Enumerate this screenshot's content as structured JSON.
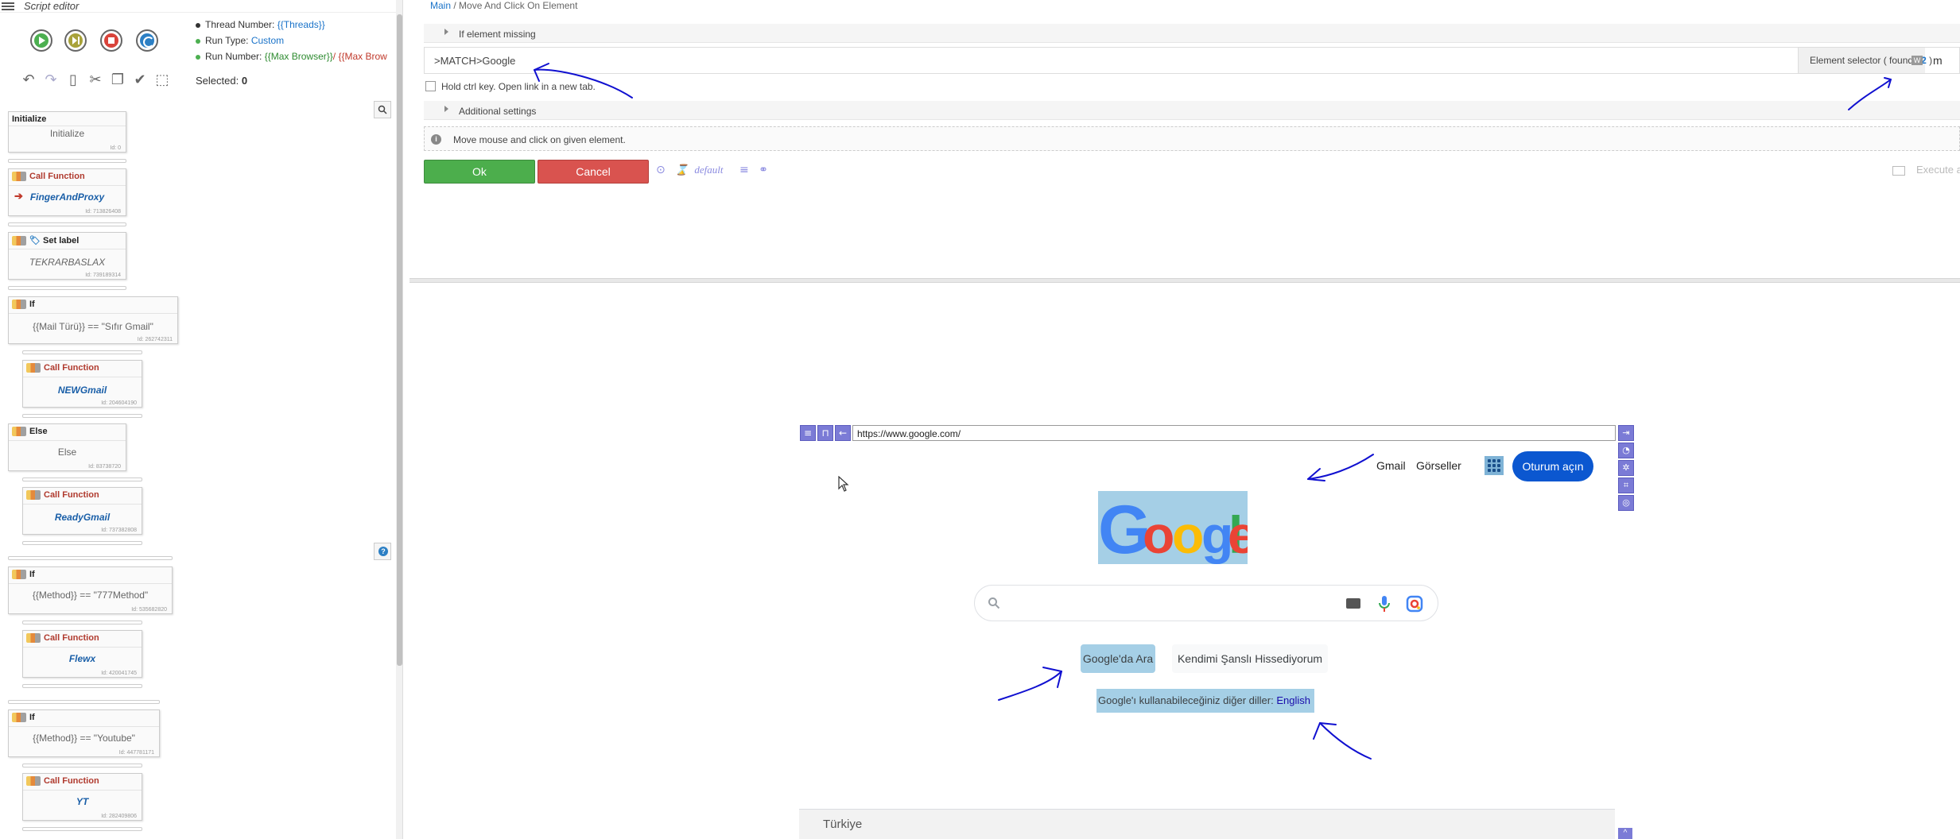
{
  "app": {
    "title": "Script editor"
  },
  "run_info": {
    "thread_label": "Thread Number:",
    "thread_value": "{{Threads}}",
    "type_label": "Run Type:",
    "type_value": "Custom",
    "number_label": "Run Number:",
    "number_value_a": "{{Max Browser}}",
    "number_sep": "/",
    "number_value_b": "{{Max Brow"
  },
  "selected": {
    "label": "Selected:",
    "count": "0"
  },
  "blocks": [
    {
      "type": "Initialize",
      "body": "Initialize",
      "id": "Id: 0"
    },
    {
      "type": "Call Function",
      "body": "FingerAndProxy",
      "id": "Id: 713826408"
    },
    {
      "type": "Set label",
      "body": "TEKRARBASLAX",
      "id": "Id: 739189314"
    },
    {
      "type": "If",
      "body": "{{Mail Türü}} == \"Sıfır Gmail\"",
      "id": "Id: 262742311"
    },
    {
      "type": "Call Function",
      "body": "NEWGmail",
      "id": "Id: 204604190"
    },
    {
      "type": "Else",
      "body": "Else",
      "id": "Id: 83738720"
    },
    {
      "type": "Call Function",
      "body": "ReadyGmail",
      "id": "Id: 737382808"
    },
    {
      "type": "If",
      "body": "{{Method}} == \"777Method\"",
      "id": "Id: 535682820"
    },
    {
      "type": "Call Function",
      "body": "Flewx",
      "id": "Id: 420041745"
    },
    {
      "type": "If",
      "body": "{{Method}} == \"Youtube\"",
      "id": "Id: 447781171"
    },
    {
      "type": "Call Function",
      "body": "YT",
      "id": "Id: 282409806"
    }
  ],
  "editor": {
    "breadcrumb_root": "Main",
    "breadcrumb_sep": "/",
    "breadcrumb_current": "Move And Click On Element",
    "if_missing": "If element missing",
    "selector_value": ">MATCH>Google",
    "selector_addon_prefix": "Element selector ( found",
    "selector_found": "12",
    "selector_addon_suffix": ")",
    "selector_addon_icon": "W",
    "selector_trailing": "m",
    "hold_ctrl": "Hold ctrl key. Open link in a new tab.",
    "additional": "Additional settings",
    "description": "Move mouse and click on given element.",
    "ok": "Ok",
    "cancel": "Cancel",
    "default_label": "default",
    "execute": "Execute a"
  },
  "browser": {
    "url": "https://www.google.com/",
    "gmail": "Gmail",
    "images": "Görseller",
    "signin": "Oturum açın",
    "btn_search": "Google'da Ara",
    "btn_lucky": "Kendimi Şanslı Hissediyorum",
    "lang_text": "Google'ı kullanabileceğiniz diğer diller:",
    "lang_link": "English",
    "footer": "Türkiye"
  },
  "colors": {
    "accent": "#1a73c9",
    "ok": "#4cae4c",
    "cancel": "#d9534f",
    "highlight": "#a5cfe6",
    "signin": "#0b57d0",
    "annotation": "#1010d0"
  }
}
